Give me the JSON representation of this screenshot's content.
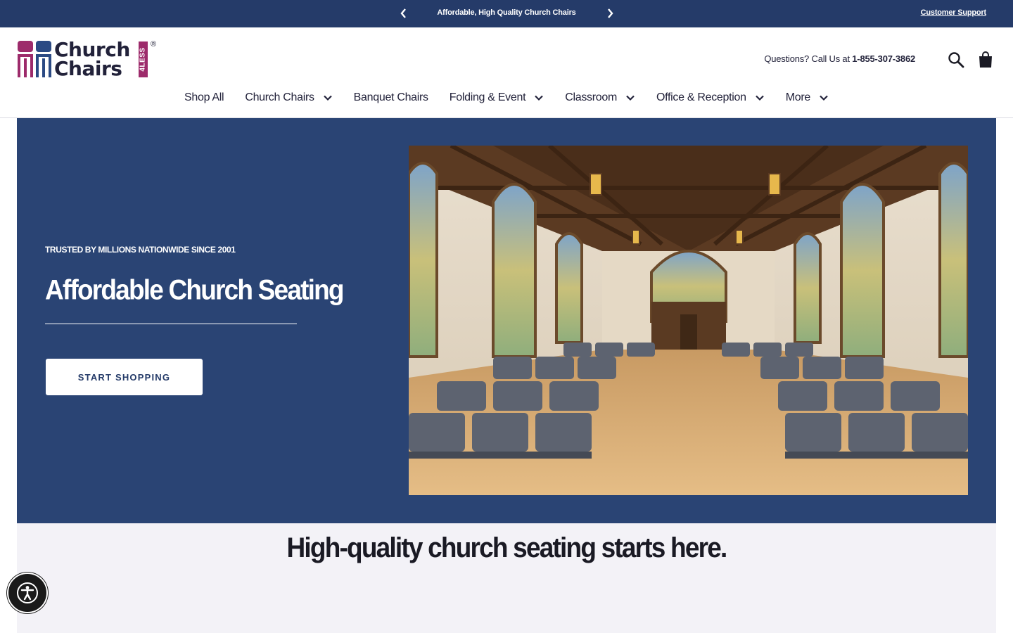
{
  "announcement": {
    "prev_icon": "chevron-left-icon",
    "text": "Affordable, High Quality Church Chairs",
    "next_icon": "chevron-right-icon",
    "support_link": "Customer Support"
  },
  "header": {
    "logo": {
      "line1": "Church",
      "line2": "Chairs",
      "badge": "4LESS",
      "reg": "®"
    },
    "phone_prefix": "Questions? Call Us at",
    "phone_number": "1-855-307-3862",
    "search_icon": "search-icon",
    "cart_icon": "shopping-bag-icon"
  },
  "nav": {
    "items": [
      {
        "label": "Shop All",
        "has_dropdown": false
      },
      {
        "label": "Church Chairs",
        "has_dropdown": true
      },
      {
        "label": "Banquet Chairs",
        "has_dropdown": false
      },
      {
        "label": "Folding & Event",
        "has_dropdown": true
      },
      {
        "label": "Classroom",
        "has_dropdown": true
      },
      {
        "label": "Office & Reception",
        "has_dropdown": true
      },
      {
        "label": "More",
        "has_dropdown": true
      }
    ]
  },
  "hero": {
    "eyebrow": "TRUSTED BY MILLIONS NATIONWIDE SINCE 2001",
    "title": "Affordable Church Seating",
    "cta": "START SHOPPING"
  },
  "section": {
    "title": "High-quality church seating starts here."
  },
  "accessibility_icon": "accessibility-icon",
  "colors": {
    "navy": "#253b69",
    "hero_bg": "#2a4474",
    "brand_magenta": "#9d2b6b",
    "brand_blue": "#2b4a84",
    "section_bg": "#f3f2f7"
  }
}
